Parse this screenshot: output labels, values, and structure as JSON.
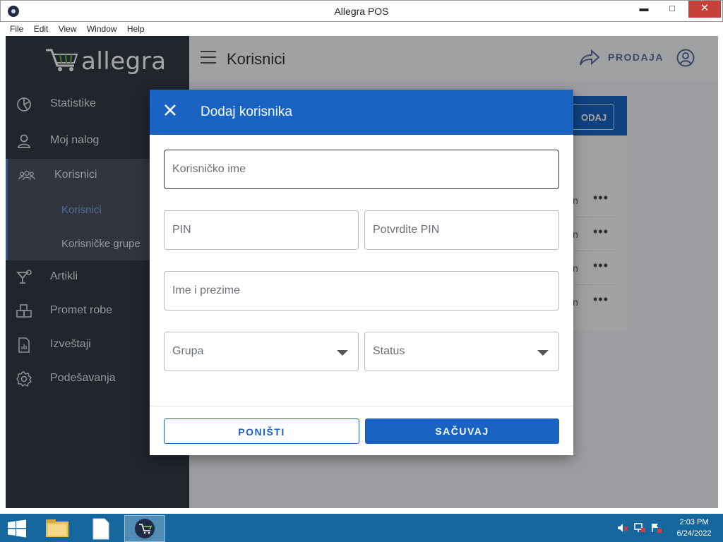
{
  "window": {
    "title": "Allegra POS",
    "minimize": "▬",
    "maximize": "□",
    "close": "✕"
  },
  "menubar": [
    "File",
    "Edit",
    "View",
    "Window",
    "Help"
  ],
  "sidebar": {
    "logo_text": "allegra",
    "items": [
      {
        "label": "Statistike",
        "icon": "pie-chart-icon"
      },
      {
        "label": "Moj nalog",
        "icon": "person-icon"
      },
      {
        "label": "Korisnici",
        "icon": "users-icon"
      },
      {
        "label": "Artikli",
        "icon": "cocktail-icon"
      },
      {
        "label": "Promet robe",
        "icon": "boxes-icon"
      },
      {
        "label": "Izveštaji",
        "icon": "report-icon"
      },
      {
        "label": "Podešavanja",
        "icon": "gear-icon"
      }
    ],
    "sub_items": [
      {
        "label": "Korisnici",
        "active": true
      },
      {
        "label": "Korisničke grupe",
        "active": false
      }
    ]
  },
  "header": {
    "title": "Korisnici",
    "sale_label": "PRODAJA"
  },
  "background_card": {
    "add_label": "ODAJ",
    "rows": [
      {
        "text": "n",
        "menu": "•••"
      },
      {
        "text": "n",
        "menu": "•••"
      },
      {
        "text": "n",
        "menu": "•••"
      },
      {
        "text": "n",
        "menu": "•••"
      }
    ]
  },
  "dialog": {
    "title": "Dodaj korisnika",
    "fields": {
      "username": "Korisničko ime",
      "pin": "PIN",
      "confirm_pin": "Potvrdite PIN",
      "full_name": "Ime i prezime",
      "group": "Grupa",
      "status": "Status"
    },
    "cancel_label": "PONIŠTI",
    "save_label": "SAČUVAJ"
  },
  "taskbar": {
    "time": "2:03 PM",
    "date": "6/24/2022"
  },
  "colors": {
    "primary": "#1b63c3",
    "sidebar": "#343a44",
    "taskbar": "#15679e"
  }
}
